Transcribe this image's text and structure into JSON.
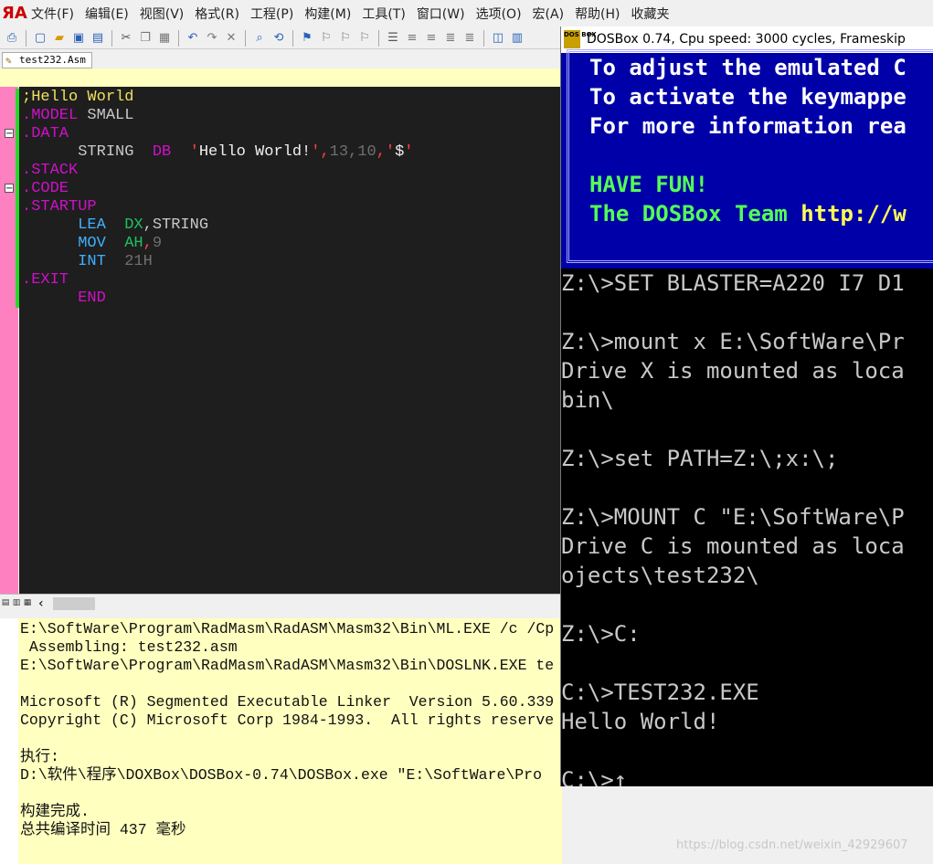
{
  "menu": [
    "文件(F)",
    "编辑(E)",
    "视图(V)",
    "格式(R)",
    "工程(P)",
    "构建(M)",
    "工具(T)",
    "窗口(W)",
    "选项(O)",
    "宏(A)",
    "帮助(H)",
    "收藏夹"
  ],
  "file_tab": "test232.Asm",
  "code": {
    "l1": ";Hello World",
    "l2a": ".MODEL",
    "l2b": " SMALL",
    "l3": ".DATA",
    "l4a": "      STRING  ",
    "l4b": "DB",
    "l4c": "  '",
    "l4d": "Hello World!",
    "l4e": "',",
    "l4f": "13",
    "l4g": ",",
    "l4h": "10",
    "l4i": ",'",
    "l4j": "$",
    "l4k": "'",
    "l5": ".STACK",
    "l6": ".CODE",
    "l7": ".STARTUP",
    "l8a": "      LEA  ",
    "l8b": "DX",
    "l8c": ",STRING",
    "l9a": "      MOV  ",
    "l9b": "AH",
    "l9c": ",",
    "l9d": "9",
    "l10a": "      INT  ",
    "l10b": "21H",
    "l11": ".EXIT",
    "l12": "      END"
  },
  "output": [
    "E:\\SoftWare\\Program\\RadMasm\\RadASM\\Masm32\\Bin\\ML.EXE /c /Cp",
    " Assembling: test232.asm",
    "E:\\SoftWare\\Program\\RadMasm\\RadASM\\Masm32\\Bin\\DOSLNK.EXE te",
    "",
    "Microsoft (R) Segmented Executable Linker  Version 5.60.339",
    "Copyright (C) Microsoft Corp 1984-1993.  All rights reserve",
    "",
    "执行:",
    "D:\\软件\\程序\\DOXBox\\DOSBox-0.74\\DOSBox.exe \"E:\\SoftWare\\Pro",
    "",
    "构建完成.",
    "总共编译时间 437 毫秒"
  ],
  "dosbox": {
    "title": "DOSBox 0.74, Cpu speed:     3000 cycles, Frameskip",
    "icon_text": "DOS BOX",
    "banner": {
      "l1": "To adjust the emulated C",
      "l2": "To activate the keymappe",
      "l3": "For more information rea",
      "l4": "HAVE FUN!",
      "l5a": "The DOSBox Team ",
      "l5b": "http://w"
    },
    "console": [
      "Z:\\>SET BLASTER=A220 I7 D1",
      "",
      "Z:\\>mount x E:\\SoftWare\\Pr",
      "Drive X is mounted as loca",
      "bin\\",
      "",
      "Z:\\>set PATH=Z:\\;x:\\;",
      "",
      "Z:\\>MOUNT C \"E:\\SoftWare\\P",
      "Drive C is mounted as loca",
      "ojects\\test232\\",
      "",
      "Z:\\>C:",
      "",
      "C:\\>TEST232.EXE",
      "Hello World!",
      "",
      "C:\\>↑"
    ]
  },
  "watermark": "https://blog.csdn.net/weixin_42929607"
}
